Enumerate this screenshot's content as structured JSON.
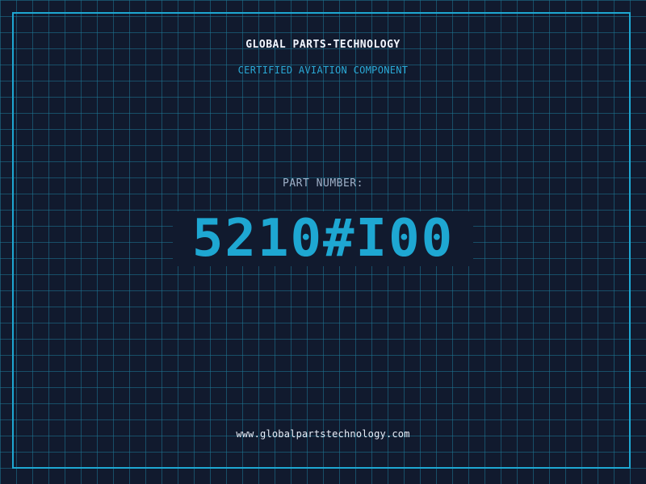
{
  "header": {
    "company": "GLOBAL PARTS-TECHNOLOGY",
    "tagline": "CERTIFIED AVIATION COMPONENT"
  },
  "part": {
    "label": "PART NUMBER:",
    "number": "5210#I00"
  },
  "footer": {
    "website": "www.globalpartstechnology.com"
  },
  "colors": {
    "background": "#111a2e",
    "grid": "#1e7896",
    "accent": "#1ea7d2",
    "title": "#f2f6ff",
    "label": "#9fb0c8"
  }
}
